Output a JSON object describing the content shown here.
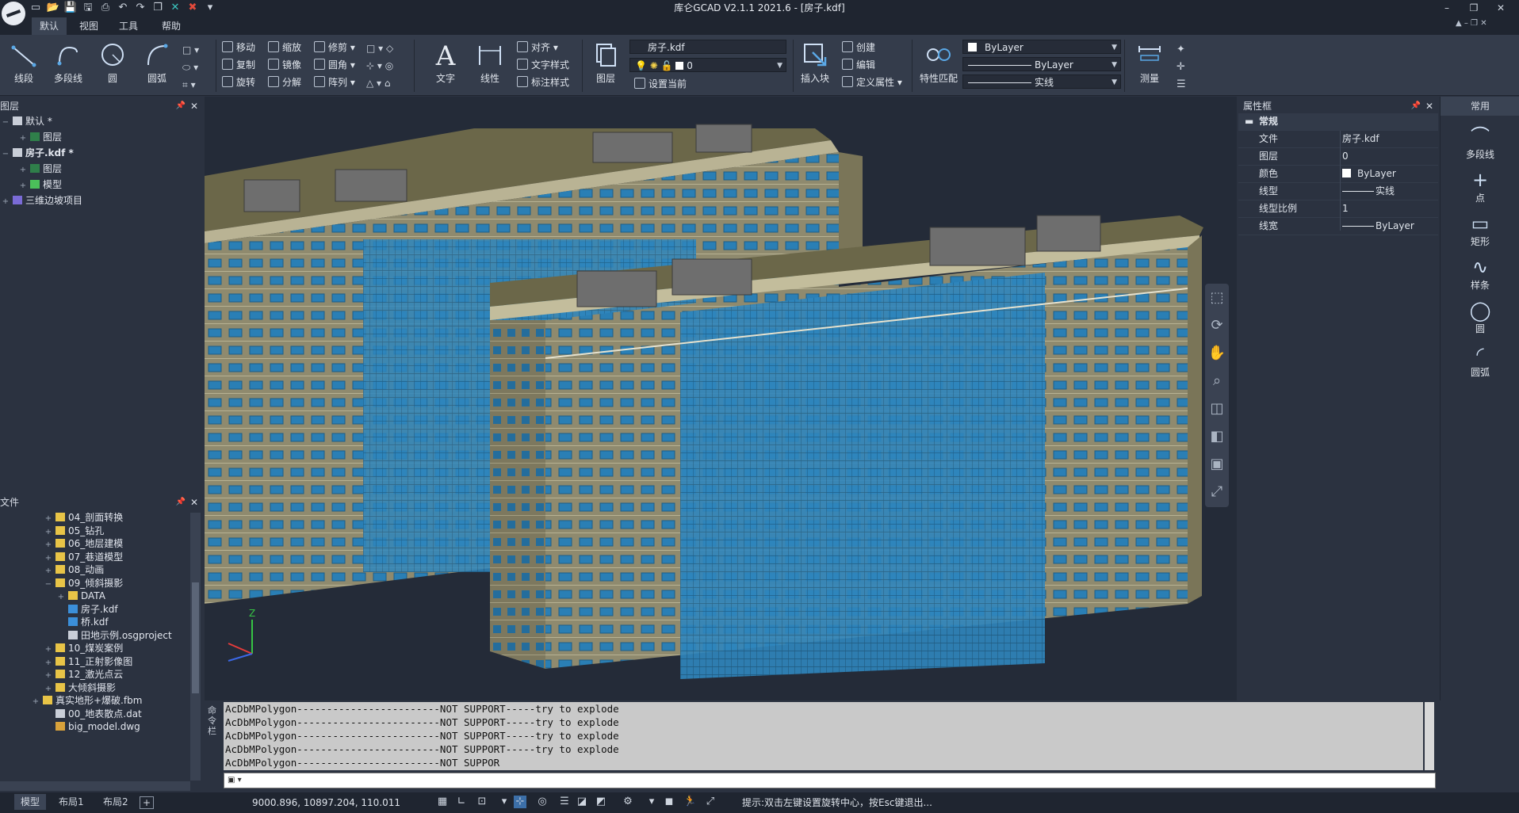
{
  "window": {
    "title": "库仑GCAD V2.1.1 2021.6 - [房子.kdf]",
    "quick_access": [
      "new-icon",
      "open-icon",
      "save-icon",
      "save-as-icon",
      "print-icon",
      "undo-icon",
      "redo-icon",
      "copy-window-icon",
      "close-doc-icon",
      "close-all-icon",
      "customize-icon"
    ],
    "controls": {
      "minimize": "–",
      "restore": "❐",
      "close": "✕"
    }
  },
  "menu": {
    "items": [
      "默认",
      "视图",
      "工具",
      "帮助"
    ],
    "active": 0
  },
  "ribbon": {
    "draw": {
      "line": "线段",
      "polyline": "多段线",
      "circle": "圆",
      "arc": "圆弧"
    },
    "modify": {
      "move": "移动",
      "scale": "缩放",
      "trim": "修剪",
      "copy": "复制",
      "mirror": "镜像",
      "fillet": "圆角",
      "rotate": "旋转",
      "explode": "分解",
      "array": "阵列"
    },
    "annotate": {
      "text": "文字",
      "linear": "线性",
      "align": "对齐",
      "text_style": "文字样式",
      "dim_style": "标注样式"
    },
    "layer": {
      "button": "图层",
      "file_combo": "房子.kdf",
      "layer_combo": "0",
      "set_current": "设置当前"
    },
    "block": {
      "insert": "插入块",
      "create": "创建",
      "edit": "编辑",
      "define_attr": "定义属性"
    },
    "props": {
      "match": "特性匹配",
      "color": "ByLayer",
      "linetype": "ByLayer",
      "lineweight": "实线"
    },
    "measure": "测量"
  },
  "layer_panel": {
    "title": "图层",
    "rows": [
      {
        "label": "默认 *",
        "level": 0,
        "toggle": "−"
      },
      {
        "label": "图层",
        "level": 1,
        "toggle": "+"
      },
      {
        "label": "房子.kdf *",
        "level": 0,
        "toggle": "−"
      },
      {
        "label": "图层",
        "level": 1,
        "toggle": "+"
      },
      {
        "label": "模型",
        "level": 1,
        "toggle": "+"
      },
      {
        "label": "三维边坡项目",
        "level": 0,
        "toggle": "+"
      }
    ]
  },
  "file_panel": {
    "title": "文件",
    "rows": [
      {
        "label": "04_剖面转换",
        "level": 1,
        "kind": "folder"
      },
      {
        "label": "05_钻孔",
        "level": 1,
        "kind": "folder"
      },
      {
        "label": "06_地层建模",
        "level": 1,
        "kind": "folder"
      },
      {
        "label": "07_巷道模型",
        "level": 1,
        "kind": "folder"
      },
      {
        "label": "08_动画",
        "level": 1,
        "kind": "folder"
      },
      {
        "label": "09_倾斜摄影",
        "level": 1,
        "kind": "folder"
      },
      {
        "label": "DATA",
        "level": 2,
        "kind": "folder"
      },
      {
        "label": "房子.kdf",
        "level": 2,
        "kind": "kdf"
      },
      {
        "label": "桥.kdf",
        "level": 2,
        "kind": "kdf"
      },
      {
        "label": "田地示例.osgproject",
        "level": 2,
        "kind": "file"
      },
      {
        "label": "10_煤炭案例",
        "level": 1,
        "kind": "folder"
      },
      {
        "label": "11_正射影像图",
        "level": 1,
        "kind": "folder"
      },
      {
        "label": "12_激光点云",
        "level": 1,
        "kind": "folder"
      },
      {
        "label": "大倾斜摄影",
        "level": 1,
        "kind": "folder"
      },
      {
        "label": "真实地形+爆破.fbm",
        "level": 0,
        "kind": "folder"
      },
      {
        "label": "00_地表散点.dat",
        "level": 1,
        "kind": "file"
      },
      {
        "label": "big_model.dwg",
        "level": 1,
        "kind": "dwg"
      }
    ]
  },
  "viewport": {
    "axis_z": "Z",
    "colors": {
      "background": "#242b38",
      "facade": "#8f8a6e",
      "roof": "#6b6749",
      "glass": "#2a7fb5"
    }
  },
  "properties": {
    "title": "属性框",
    "group": "常规",
    "rows": [
      {
        "key": "文件",
        "value": "房子.kdf"
      },
      {
        "key": "图层",
        "value": "0"
      },
      {
        "key": "颜色",
        "value": "ByLayer"
      },
      {
        "key": "线型",
        "value": "实线"
      },
      {
        "key": "线型比例",
        "value": "1"
      },
      {
        "key": "线宽",
        "value": "ByLayer"
      }
    ]
  },
  "palette": {
    "title": "常用",
    "items": [
      "多段线",
      "点",
      "矩形",
      "样条",
      "圆",
      "圆弧"
    ]
  },
  "command": {
    "side_label": "命令栏",
    "lines": [
      "AcDbMPolygon------------------------NOT SUPPORT-----try to explode",
      "AcDbMPolygon------------------------NOT SUPPORT-----try to explode",
      "AcDbMPolygon------------------------NOT SUPPORT-----try to explode",
      "AcDbMPolygon------------------------NOT SUPPORT-----try to explode",
      "AcDbMPolygon------------------------NOT SUPPOR"
    ]
  },
  "status": {
    "tabs": [
      "模型",
      "布局1",
      "布局2"
    ],
    "add_tab": "+",
    "coords": "9000.896, 10897.204, 110.011",
    "hint": "提示:双击左键设置旋转中心，按Esc键退出..."
  }
}
